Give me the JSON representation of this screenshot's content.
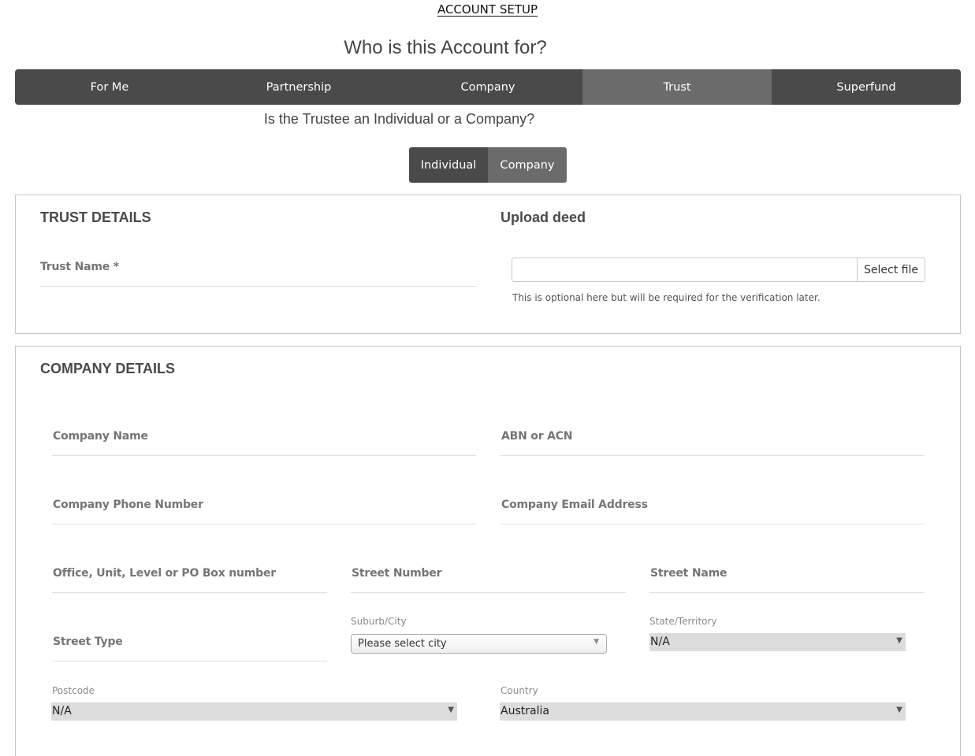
{
  "page": {
    "heading": "ACCOUNT SETUP",
    "question_account": "Who is this Account for?",
    "question_trustee": "Is the Trustee an Individual or a Company?"
  },
  "account_tabs": [
    {
      "label": "For Me",
      "active": false
    },
    {
      "label": "Partnership",
      "active": false
    },
    {
      "label": "Company",
      "active": false
    },
    {
      "label": "Trust",
      "active": true
    },
    {
      "label": "Superfund",
      "active": false
    }
  ],
  "trustee_toggle": {
    "individual": "Individual",
    "company": "Company"
  },
  "trust_details": {
    "title": "TRUST DETAILS",
    "trust_name_label": "Trust Name *"
  },
  "upload": {
    "title": "Upload deed",
    "select_file": "Select file",
    "hint": "This is optional here but will be required for the verification later."
  },
  "company_details": {
    "title": "COMPANY DETAILS",
    "company_name": "Company Name",
    "abn_acn": "ABN or ACN",
    "phone": "Company Phone Number",
    "email": "Company Email Address",
    "office_unit": "Office, Unit, Level or PO Box number",
    "street_number": "Street Number",
    "street_name": "Street Name",
    "street_type": "Street Type",
    "suburb_label": "Suburb/City",
    "suburb_value": "Please select city",
    "state_label": "State/Territory",
    "state_value": "N/A",
    "postcode_label": "Postcode",
    "postcode_value": "N/A",
    "country_label": "Country",
    "country_value": "Australia"
  },
  "icons": {
    "select_caret": "caret-down-icon"
  },
  "colors": {
    "tab_bg": "#4a4a4a",
    "tab_active_bg": "#6b6b6b"
  }
}
